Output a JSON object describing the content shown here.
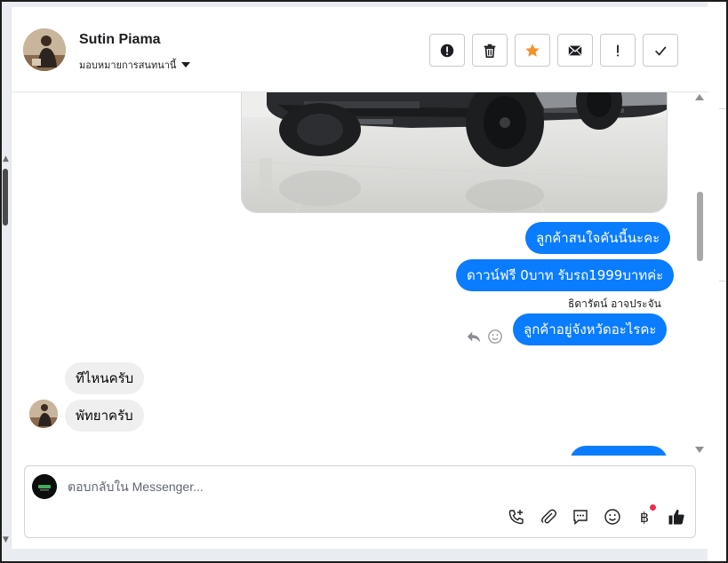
{
  "header": {
    "contact_name": "Sutin Piama",
    "assign_label": "มอบหมายการสนทนานี้",
    "actions": [
      {
        "name": "report-button",
        "icon": "exclamation-circle-icon"
      },
      {
        "name": "delete-button",
        "icon": "trash-icon"
      },
      {
        "name": "star-button",
        "icon": "star-icon",
        "color": "#f5922e"
      },
      {
        "name": "mark-unread-button",
        "icon": "envelope-icon"
      },
      {
        "name": "spam-button",
        "icon": "exclamation-icon"
      },
      {
        "name": "mark-done-button",
        "icon": "check-icon"
      }
    ]
  },
  "messages": {
    "out_1": "ลูกค้าสนใจคันนี้นะคะ",
    "out_2": "ดาวน์ฟรี 0บาท รับรถ1999บาทค่ะ",
    "sender": "ธิดารัตน์ อาจประจัน",
    "out_3": "ลูกค้าอยู่จังหวัดอะไรคะ",
    "in_1": "ทีไหนครับ",
    "in_2": "พัทยาครับ"
  },
  "composer": {
    "placeholder": "ตอบกลับใน Messenger...",
    "tools": [
      "call-plus-icon",
      "paperclip-icon",
      "saved-reply-icon",
      "emoji-icon",
      "baht-icon",
      "thumbs-up-icon"
    ],
    "baht_symbol": "฿"
  },
  "colors": {
    "outgoing_bubble": "#0a7cff",
    "incoming_bubble": "#efefef",
    "star": "#f5922e",
    "notification_dot": "#f02849"
  }
}
